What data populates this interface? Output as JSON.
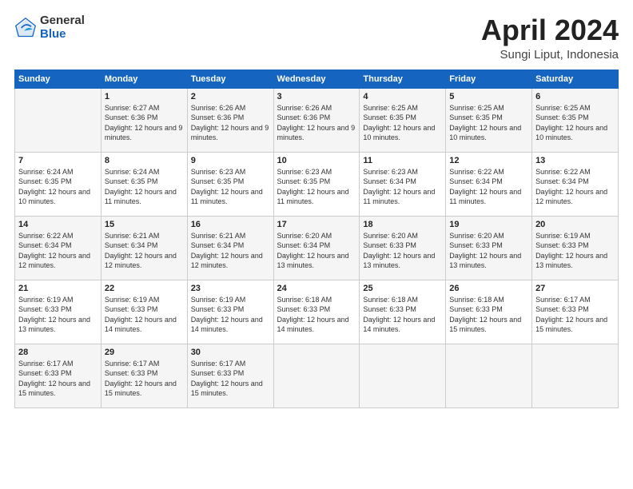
{
  "logo": {
    "general": "General",
    "blue": "Blue"
  },
  "title": {
    "month_year": "April 2024",
    "location": "Sungi Liput, Indonesia"
  },
  "weekdays": [
    "Sunday",
    "Monday",
    "Tuesday",
    "Wednesday",
    "Thursday",
    "Friday",
    "Saturday"
  ],
  "weeks": [
    [
      {
        "day": "",
        "sunrise": "",
        "sunset": "",
        "daylight": ""
      },
      {
        "day": "1",
        "sunrise": "Sunrise: 6:27 AM",
        "sunset": "Sunset: 6:36 PM",
        "daylight": "Daylight: 12 hours and 9 minutes."
      },
      {
        "day": "2",
        "sunrise": "Sunrise: 6:26 AM",
        "sunset": "Sunset: 6:36 PM",
        "daylight": "Daylight: 12 hours and 9 minutes."
      },
      {
        "day": "3",
        "sunrise": "Sunrise: 6:26 AM",
        "sunset": "Sunset: 6:36 PM",
        "daylight": "Daylight: 12 hours and 9 minutes."
      },
      {
        "day": "4",
        "sunrise": "Sunrise: 6:25 AM",
        "sunset": "Sunset: 6:35 PM",
        "daylight": "Daylight: 12 hours and 10 minutes."
      },
      {
        "day": "5",
        "sunrise": "Sunrise: 6:25 AM",
        "sunset": "Sunset: 6:35 PM",
        "daylight": "Daylight: 12 hours and 10 minutes."
      },
      {
        "day": "6",
        "sunrise": "Sunrise: 6:25 AM",
        "sunset": "Sunset: 6:35 PM",
        "daylight": "Daylight: 12 hours and 10 minutes."
      }
    ],
    [
      {
        "day": "7",
        "sunrise": "Sunrise: 6:24 AM",
        "sunset": "Sunset: 6:35 PM",
        "daylight": "Daylight: 12 hours and 10 minutes."
      },
      {
        "day": "8",
        "sunrise": "Sunrise: 6:24 AM",
        "sunset": "Sunset: 6:35 PM",
        "daylight": "Daylight: 12 hours and 11 minutes."
      },
      {
        "day": "9",
        "sunrise": "Sunrise: 6:23 AM",
        "sunset": "Sunset: 6:35 PM",
        "daylight": "Daylight: 12 hours and 11 minutes."
      },
      {
        "day": "10",
        "sunrise": "Sunrise: 6:23 AM",
        "sunset": "Sunset: 6:35 PM",
        "daylight": "Daylight: 12 hours and 11 minutes."
      },
      {
        "day": "11",
        "sunrise": "Sunrise: 6:23 AM",
        "sunset": "Sunset: 6:34 PM",
        "daylight": "Daylight: 12 hours and 11 minutes."
      },
      {
        "day": "12",
        "sunrise": "Sunrise: 6:22 AM",
        "sunset": "Sunset: 6:34 PM",
        "daylight": "Daylight: 12 hours and 11 minutes."
      },
      {
        "day": "13",
        "sunrise": "Sunrise: 6:22 AM",
        "sunset": "Sunset: 6:34 PM",
        "daylight": "Daylight: 12 hours and 12 minutes."
      }
    ],
    [
      {
        "day": "14",
        "sunrise": "Sunrise: 6:22 AM",
        "sunset": "Sunset: 6:34 PM",
        "daylight": "Daylight: 12 hours and 12 minutes."
      },
      {
        "day": "15",
        "sunrise": "Sunrise: 6:21 AM",
        "sunset": "Sunset: 6:34 PM",
        "daylight": "Daylight: 12 hours and 12 minutes."
      },
      {
        "day": "16",
        "sunrise": "Sunrise: 6:21 AM",
        "sunset": "Sunset: 6:34 PM",
        "daylight": "Daylight: 12 hours and 12 minutes."
      },
      {
        "day": "17",
        "sunrise": "Sunrise: 6:20 AM",
        "sunset": "Sunset: 6:34 PM",
        "daylight": "Daylight: 12 hours and 13 minutes."
      },
      {
        "day": "18",
        "sunrise": "Sunrise: 6:20 AM",
        "sunset": "Sunset: 6:33 PM",
        "daylight": "Daylight: 12 hours and 13 minutes."
      },
      {
        "day": "19",
        "sunrise": "Sunrise: 6:20 AM",
        "sunset": "Sunset: 6:33 PM",
        "daylight": "Daylight: 12 hours and 13 minutes."
      },
      {
        "day": "20",
        "sunrise": "Sunrise: 6:19 AM",
        "sunset": "Sunset: 6:33 PM",
        "daylight": "Daylight: 12 hours and 13 minutes."
      }
    ],
    [
      {
        "day": "21",
        "sunrise": "Sunrise: 6:19 AM",
        "sunset": "Sunset: 6:33 PM",
        "daylight": "Daylight: 12 hours and 13 minutes."
      },
      {
        "day": "22",
        "sunrise": "Sunrise: 6:19 AM",
        "sunset": "Sunset: 6:33 PM",
        "daylight": "Daylight: 12 hours and 14 minutes."
      },
      {
        "day": "23",
        "sunrise": "Sunrise: 6:19 AM",
        "sunset": "Sunset: 6:33 PM",
        "daylight": "Daylight: 12 hours and 14 minutes."
      },
      {
        "day": "24",
        "sunrise": "Sunrise: 6:18 AM",
        "sunset": "Sunset: 6:33 PM",
        "daylight": "Daylight: 12 hours and 14 minutes."
      },
      {
        "day": "25",
        "sunrise": "Sunrise: 6:18 AM",
        "sunset": "Sunset: 6:33 PM",
        "daylight": "Daylight: 12 hours and 14 minutes."
      },
      {
        "day": "26",
        "sunrise": "Sunrise: 6:18 AM",
        "sunset": "Sunset: 6:33 PM",
        "daylight": "Daylight: 12 hours and 15 minutes."
      },
      {
        "day": "27",
        "sunrise": "Sunrise: 6:17 AM",
        "sunset": "Sunset: 6:33 PM",
        "daylight": "Daylight: 12 hours and 15 minutes."
      }
    ],
    [
      {
        "day": "28",
        "sunrise": "Sunrise: 6:17 AM",
        "sunset": "Sunset: 6:33 PM",
        "daylight": "Daylight: 12 hours and 15 minutes."
      },
      {
        "day": "29",
        "sunrise": "Sunrise: 6:17 AM",
        "sunset": "Sunset: 6:33 PM",
        "daylight": "Daylight: 12 hours and 15 minutes."
      },
      {
        "day": "30",
        "sunrise": "Sunrise: 6:17 AM",
        "sunset": "Sunset: 6:33 PM",
        "daylight": "Daylight: 12 hours and 15 minutes."
      },
      {
        "day": "",
        "sunrise": "",
        "sunset": "",
        "daylight": ""
      },
      {
        "day": "",
        "sunrise": "",
        "sunset": "",
        "daylight": ""
      },
      {
        "day": "",
        "sunrise": "",
        "sunset": "",
        "daylight": ""
      },
      {
        "day": "",
        "sunrise": "",
        "sunset": "",
        "daylight": ""
      }
    ]
  ]
}
